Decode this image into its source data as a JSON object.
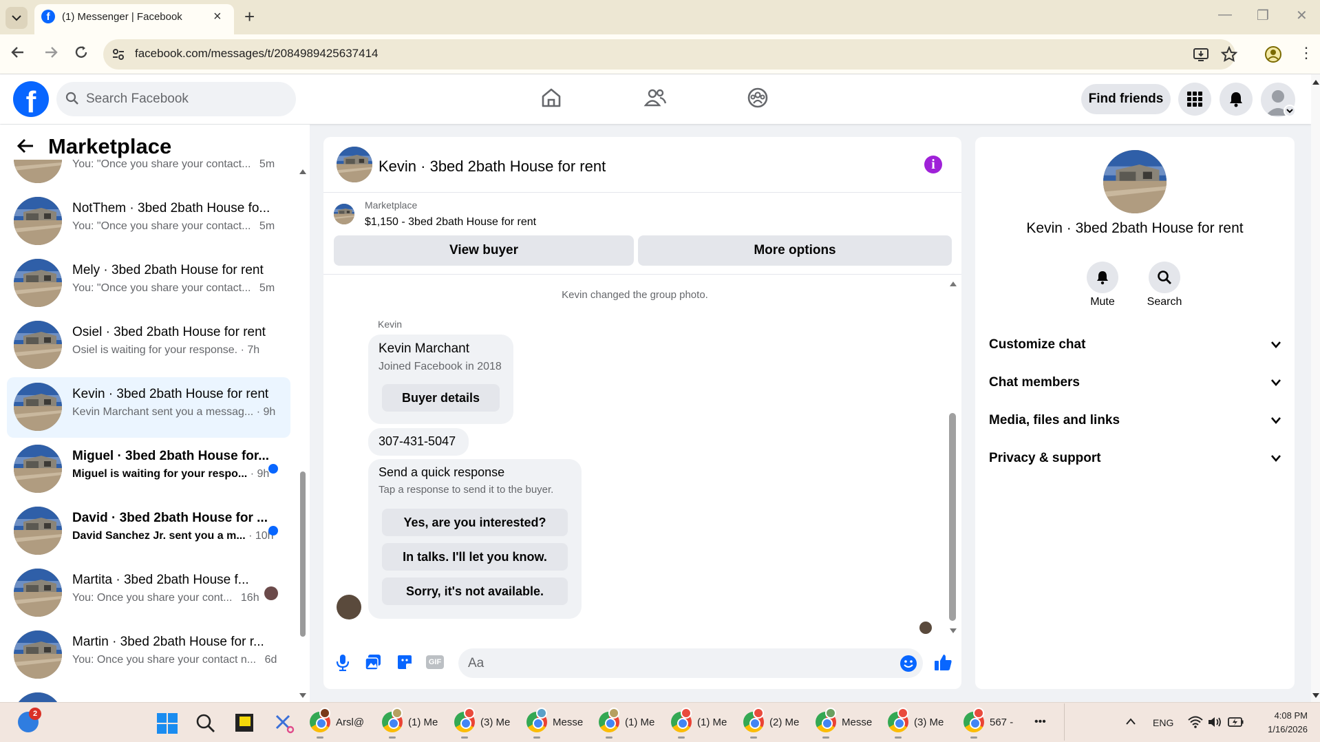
{
  "browser": {
    "tab_title": "(1) Messenger | Facebook",
    "url": "facebook.com/messages/t/2084989425637414",
    "win_min": "—",
    "win_max": "❐",
    "win_close": "✕"
  },
  "header": {
    "search_placeholder": "Search Facebook",
    "find_friends_label": "Find friends"
  },
  "sidebar": {
    "title": "Marketplace",
    "items": [
      {
        "name": "",
        "snippet": "You: \"Once you share your contact...",
        "time": "5m"
      },
      {
        "name": "NotThem · 3bed 2bath House fo...",
        "snippet": "You: \"Once you share your contact...",
        "time": "5m"
      },
      {
        "name": "Mely · 3bed 2bath House for rent",
        "snippet": "You: \"Once you share your contact...",
        "time": "5m"
      },
      {
        "name": "Osiel · 3bed 2bath House for rent",
        "snippet": "Osiel is waiting for your response.",
        "time": "· 7h"
      },
      {
        "name": "Kevin · 3bed 2bath House for rent",
        "snippet": "Kevin Marchant sent you a messag...",
        "time": "· 9h"
      },
      {
        "name": "Miguel · 3bed 2bath House for...",
        "snippet": "Miguel is waiting for your respo...",
        "time": "· 9h"
      },
      {
        "name": "David · 3bed 2bath House for ...",
        "snippet": "David Sanchez Jr. sent you a m...",
        "time": "· 10h"
      },
      {
        "name": "Martita · 3bed 2bath House f...",
        "snippet": "You: Once you share your cont...",
        "time": "16h"
      },
      {
        "name": "Martin · 3bed 2bath House for r...",
        "snippet": "You: Once you share your contact n...",
        "time": "6d"
      }
    ]
  },
  "chat": {
    "title": "Kevin · 3bed 2bath House for rent",
    "listing_source": "Marketplace",
    "listing_title": "$1,150 - 3bed 2bath House for rent",
    "view_buyer_label": "View buyer",
    "more_options_label": "More options",
    "system_message": "Kevin changed the group photo.",
    "sender": "Kevin",
    "profile_name": "Kevin Marchant",
    "profile_sub": "Joined Facebook in 2018",
    "buyer_details_label": "Buyer details",
    "phone_message": "307-431-5047",
    "quick_title": "Send a quick response",
    "quick_sub": "Tap a response to send it to the buyer.",
    "quick_replies": [
      "Yes, are you interested?",
      "In talks. I'll let you know.",
      "Sorry, it's not available."
    ],
    "composer_placeholder": "Aa",
    "gif_label": "GIF"
  },
  "details": {
    "title": "Kevin · 3bed 2bath House for rent",
    "mute_label": "Mute",
    "search_label": "Search",
    "sections": [
      "Customize chat",
      "Chat members",
      "Media, files and links",
      "Privacy & support"
    ]
  },
  "taskbar": {
    "apps": [
      {
        "label": "Arsl@"
      },
      {
        "label": "(1) Me"
      },
      {
        "label": "(3) Me"
      },
      {
        "label": "Messe"
      },
      {
        "label": "(1) Me"
      },
      {
        "label": "(1) Me"
      },
      {
        "label": "(2) Me"
      },
      {
        "label": "Messe"
      },
      {
        "label": "(3) Me"
      },
      {
        "label": "567 -"
      }
    ],
    "widget_badge": "2",
    "more": "•••",
    "lang": "ENG",
    "time": "4:08 PM",
    "date": "1/16/2026"
  },
  "colors": {
    "brand": "#0866ff",
    "info": "#9f21d8",
    "active_row": "#ebf5ff"
  }
}
